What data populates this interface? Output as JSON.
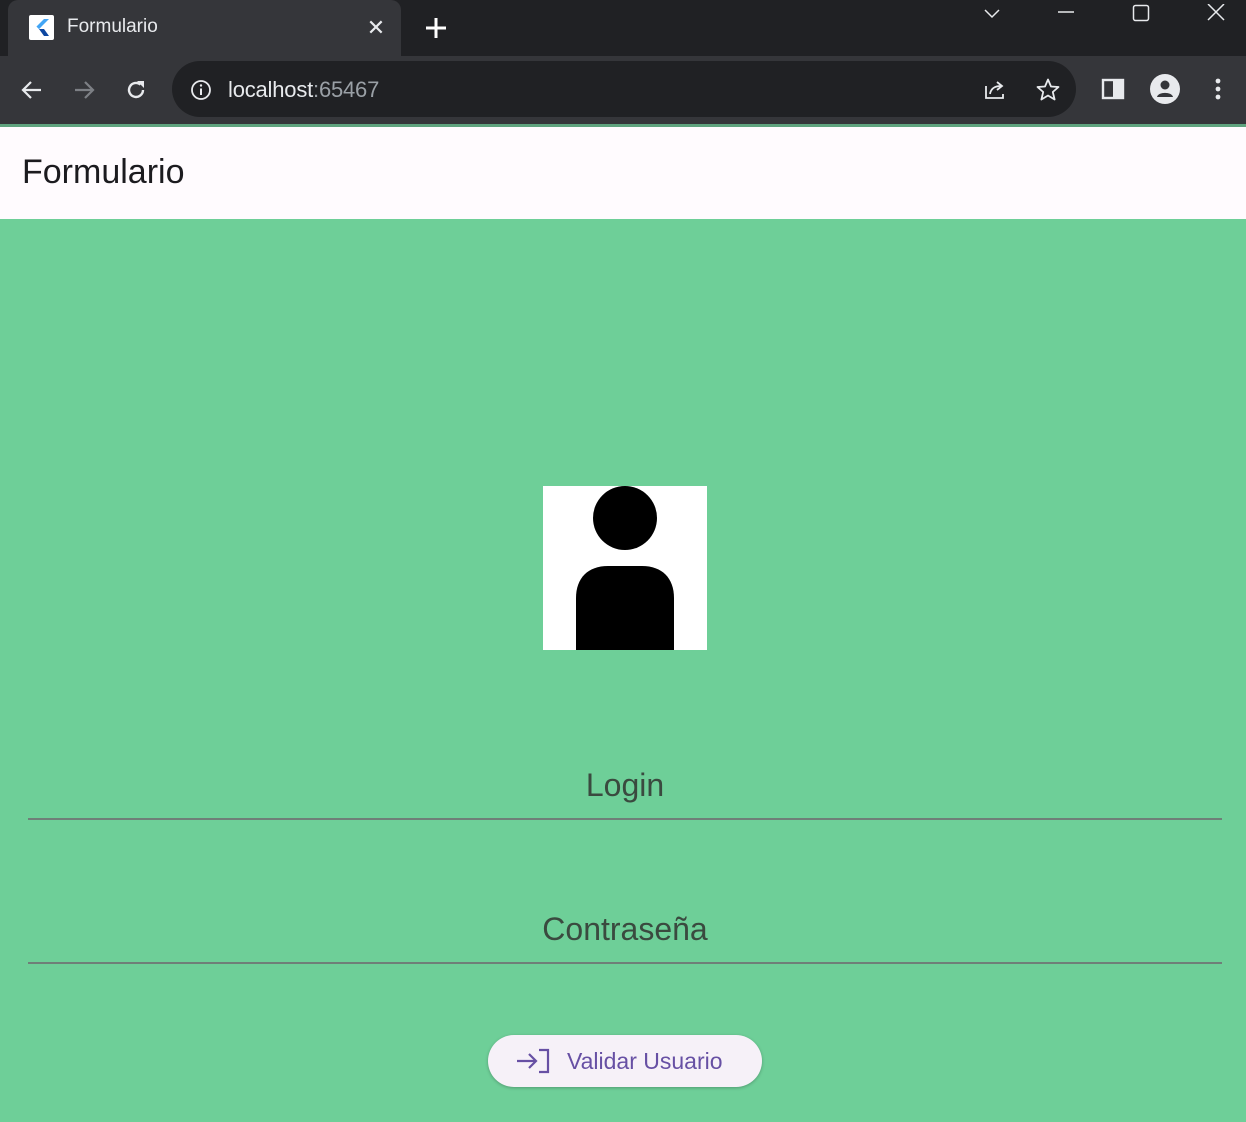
{
  "browser": {
    "tab_title": "Formulario",
    "url_host": "localhost",
    "url_port": ":65467"
  },
  "app": {
    "title": "Formulario",
    "fields": {
      "login_label": "Login",
      "password_label": "Contraseña"
    },
    "validate_button_label": "Validar Usuario"
  },
  "icons": {
    "favicon": "flutter-logo",
    "avatar": "person-icon",
    "button_icon": "login-arrow-icon"
  },
  "colors": {
    "background": "#6ecf98",
    "appbar": "#fffbfe",
    "button_text": "#6750a4"
  }
}
